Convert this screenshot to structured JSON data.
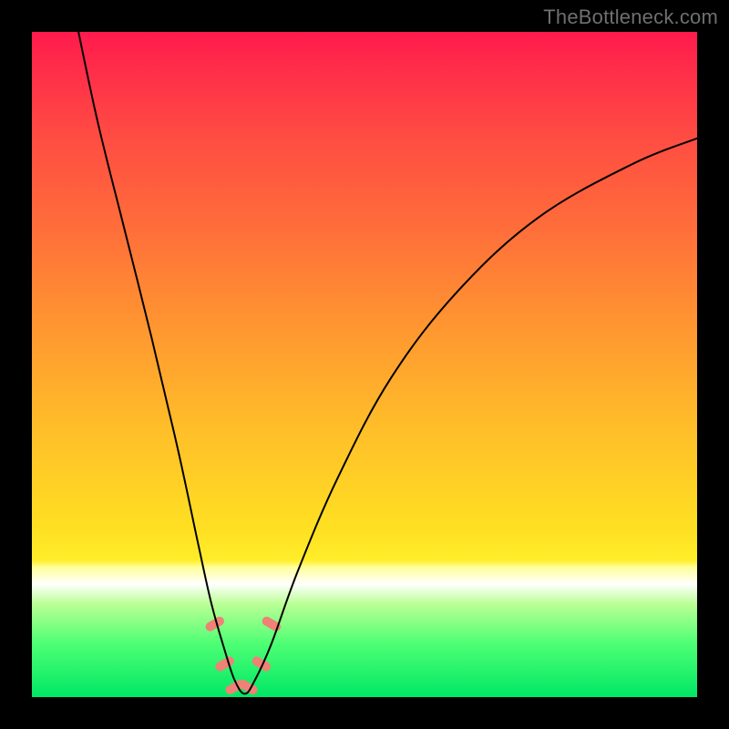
{
  "watermark": "TheBottleneck.com",
  "chart_data": {
    "type": "line",
    "title": "",
    "xlabel": "",
    "ylabel": "",
    "xlim": [
      0,
      100
    ],
    "ylim": [
      0,
      100
    ],
    "grid": false,
    "legend": false,
    "background_gradient": {
      "direction": "vertical",
      "stops": [
        {
          "pos": 0.0,
          "color": "#ff1a4d"
        },
        {
          "pos": 0.15,
          "color": "#ff4a43"
        },
        {
          "pos": 0.3,
          "color": "#ff6f3a"
        },
        {
          "pos": 0.45,
          "color": "#ff9830"
        },
        {
          "pos": 0.6,
          "color": "#ffbf29"
        },
        {
          "pos": 0.75,
          "color": "#ffe022"
        },
        {
          "pos": 0.795,
          "color": "#ffee2a"
        },
        {
          "pos": 0.805,
          "color": "#ffff9a"
        },
        {
          "pos": 0.83,
          "color": "#ffffff"
        },
        {
          "pos": 0.86,
          "color": "#baff94"
        },
        {
          "pos": 0.92,
          "color": "#4dff74"
        },
        {
          "pos": 1.0,
          "color": "#00e765"
        }
      ]
    },
    "series": [
      {
        "name": "bottleneck-curve",
        "color": "#000000",
        "x": [
          7,
          10,
          14,
          18,
          22,
          25,
          27,
          29,
          30.5,
          32,
          33.5,
          36,
          40,
          46,
          54,
          64,
          76,
          90,
          100
        ],
        "y": [
          100,
          86,
          70,
          54,
          37,
          23,
          14,
          7,
          2.5,
          0.5,
          2.5,
          8,
          19,
          33,
          48,
          61,
          72,
          80,
          84
        ]
      }
    ],
    "markers": {
      "name": "highlight-beads",
      "color": "#f08177",
      "shape": "capsule",
      "points": [
        {
          "x": 27.5,
          "y": 11
        },
        {
          "x": 29.0,
          "y": 5
        },
        {
          "x": 30.5,
          "y": 1.5
        },
        {
          "x": 32.5,
          "y": 1.5
        },
        {
          "x": 34.5,
          "y": 5
        },
        {
          "x": 36.0,
          "y": 11
        }
      ]
    }
  }
}
